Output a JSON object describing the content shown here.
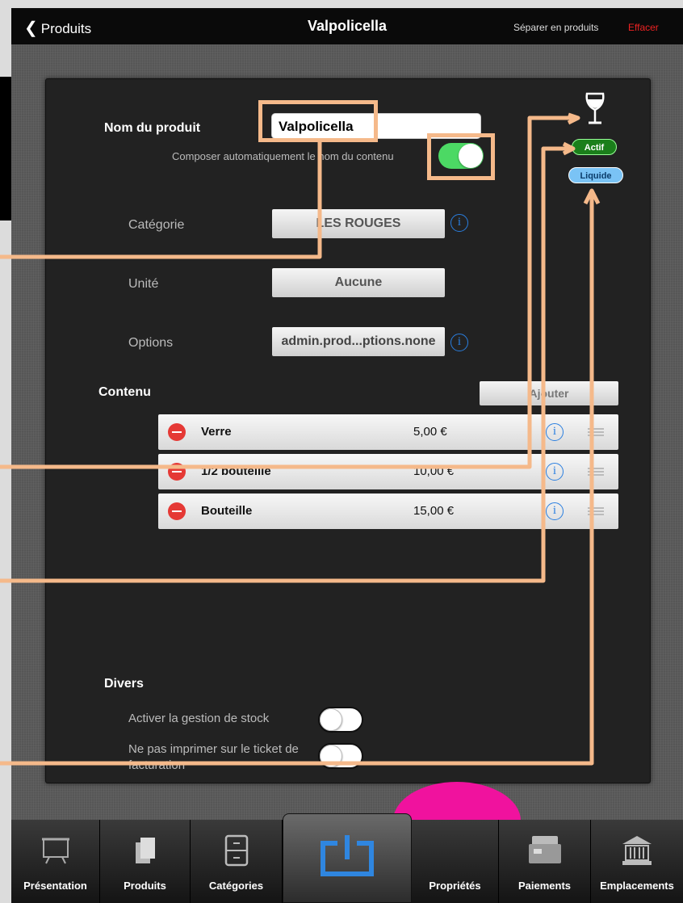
{
  "header": {
    "back_label": "Produits",
    "title": "Valpolicella",
    "split_label": "Séparer en produits",
    "erase_label": "Effacer"
  },
  "form": {
    "name_label": "Nom du produit",
    "name_value": "Valpolicella",
    "compose_label": "Composer automatiquement le nom du contenu",
    "compose_on": true,
    "category_label": "Catégorie",
    "category_value": "LES ROUGES",
    "unit_label": "Unité",
    "unit_value": "Aucune",
    "options_label": "Options",
    "options_value": "admin.prod...ptions.none"
  },
  "content": {
    "title": "Contenu",
    "add_label": "Ajouter",
    "rows": [
      {
        "name": "Verre",
        "price": "5,00 €"
      },
      {
        "name": "1/2 bouteille",
        "price": "10,00 €"
      },
      {
        "name": "Bouteille",
        "price": "15,00 €"
      }
    ]
  },
  "misc": {
    "title": "Divers",
    "stock_label": "Activer la gestion de stock",
    "noprint_label": "Ne pas imprimer sur le ticket de facturation"
  },
  "badges": {
    "actif": "Actif",
    "liquide": "Liquide"
  },
  "tabs": [
    {
      "label": "Présentation",
      "icon": "presentation-icon"
    },
    {
      "label": "Produits",
      "icon": "products-icon"
    },
    {
      "label": "Catégories",
      "icon": "categories-icon"
    },
    {
      "label": "",
      "icon": "power-icon"
    },
    {
      "label": "Propriétés",
      "icon": "properties-icon"
    },
    {
      "label": "Paiements",
      "icon": "payments-icon"
    },
    {
      "label": "Emplacements",
      "icon": "locations-icon"
    }
  ],
  "colors": {
    "accent_annotation": "#f5b98a",
    "toggle_on": "#4cd964",
    "erase": "#e22222",
    "magenta_blob": "#f0129e"
  }
}
